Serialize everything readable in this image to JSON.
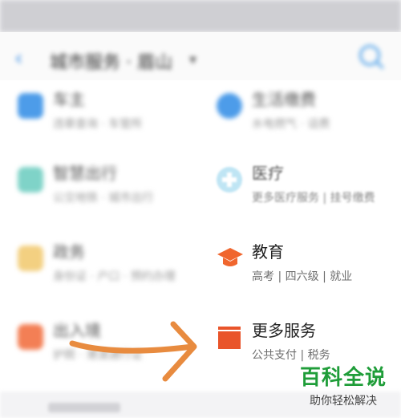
{
  "header": {
    "back_glyph": "‹",
    "title": "城市服务 · 眉山",
    "title_chevron": "▾"
  },
  "services": [
    {
      "name": "车主",
      "desc": "违章查询 · 车管所",
      "icon": "car-icon",
      "color": "#4d9ce9",
      "blurred": true
    },
    {
      "name": "生活缴费",
      "desc": "水电燃气 · 话费",
      "icon": "lightning-icon",
      "color": "#4d9ce9",
      "blurred": true
    },
    {
      "name": "智慧出行",
      "desc": "公交地铁 · 城市出行",
      "icon": "bus-icon",
      "color": "#7fd3c8",
      "blurred": true
    },
    {
      "name": "医疗",
      "desc": "更多医疗服务 | 挂号缴费",
      "icon": "medical-icon",
      "color": "#bfe5f4",
      "blurred": true
    },
    {
      "name": "政务",
      "desc": "身份证 · 户口 · 预约办理",
      "icon": "government-icon",
      "color": "#f3d081",
      "blurred": true
    },
    {
      "name": "教育",
      "desc": "高考 | 四六级 | 就业",
      "icon": "graduation-cap-icon",
      "color": "#f0662e",
      "blurred": false
    },
    {
      "name": "出入境",
      "desc": "护照 · 港澳通行证",
      "icon": "passport-icon",
      "color": "#f37f55",
      "blurred": true
    },
    {
      "name": "更多服务",
      "desc": "公共支付 | 税务",
      "icon": "box-icon",
      "color": "#e9542a",
      "blurred": false
    }
  ],
  "annotation": {
    "icon": "hand-drawn-arrow-icon",
    "color": "#e88b3f"
  },
  "watermark": {
    "main": "百科全说",
    "sub": "助你轻松解决"
  }
}
